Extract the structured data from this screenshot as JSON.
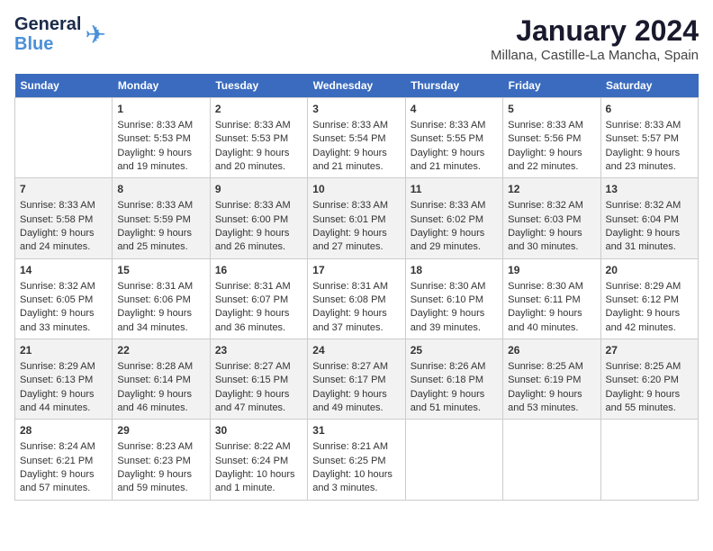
{
  "header": {
    "logo_line1": "General",
    "logo_line2": "Blue",
    "title": "January 2024",
    "subtitle": "Millana, Castille-La Mancha, Spain"
  },
  "weekdays": [
    "Sunday",
    "Monday",
    "Tuesday",
    "Wednesday",
    "Thursday",
    "Friday",
    "Saturday"
  ],
  "weeks": [
    [
      {
        "day": "",
        "empty": true
      },
      {
        "day": "1",
        "sunrise": "8:33 AM",
        "sunset": "5:53 PM",
        "daylight": "9 hours and 19 minutes."
      },
      {
        "day": "2",
        "sunrise": "8:33 AM",
        "sunset": "5:53 PM",
        "daylight": "9 hours and 20 minutes."
      },
      {
        "day": "3",
        "sunrise": "8:33 AM",
        "sunset": "5:54 PM",
        "daylight": "9 hours and 21 minutes."
      },
      {
        "day": "4",
        "sunrise": "8:33 AM",
        "sunset": "5:55 PM",
        "daylight": "9 hours and 21 minutes."
      },
      {
        "day": "5",
        "sunrise": "8:33 AM",
        "sunset": "5:56 PM",
        "daylight": "9 hours and 22 minutes."
      },
      {
        "day": "6",
        "sunrise": "8:33 AM",
        "sunset": "5:57 PM",
        "daylight": "9 hours and 23 minutes."
      }
    ],
    [
      {
        "day": "7",
        "sunrise": "8:33 AM",
        "sunset": "5:58 PM",
        "daylight": "9 hours and 24 minutes."
      },
      {
        "day": "8",
        "sunrise": "8:33 AM",
        "sunset": "5:59 PM",
        "daylight": "9 hours and 25 minutes."
      },
      {
        "day": "9",
        "sunrise": "8:33 AM",
        "sunset": "6:00 PM",
        "daylight": "9 hours and 26 minutes."
      },
      {
        "day": "10",
        "sunrise": "8:33 AM",
        "sunset": "6:01 PM",
        "daylight": "9 hours and 27 minutes."
      },
      {
        "day": "11",
        "sunrise": "8:33 AM",
        "sunset": "6:02 PM",
        "daylight": "9 hours and 29 minutes."
      },
      {
        "day": "12",
        "sunrise": "8:32 AM",
        "sunset": "6:03 PM",
        "daylight": "9 hours and 30 minutes."
      },
      {
        "day": "13",
        "sunrise": "8:32 AM",
        "sunset": "6:04 PM",
        "daylight": "9 hours and 31 minutes."
      }
    ],
    [
      {
        "day": "14",
        "sunrise": "8:32 AM",
        "sunset": "6:05 PM",
        "daylight": "9 hours and 33 minutes."
      },
      {
        "day": "15",
        "sunrise": "8:31 AM",
        "sunset": "6:06 PM",
        "daylight": "9 hours and 34 minutes."
      },
      {
        "day": "16",
        "sunrise": "8:31 AM",
        "sunset": "6:07 PM",
        "daylight": "9 hours and 36 minutes."
      },
      {
        "day": "17",
        "sunrise": "8:31 AM",
        "sunset": "6:08 PM",
        "daylight": "9 hours and 37 minutes."
      },
      {
        "day": "18",
        "sunrise": "8:30 AM",
        "sunset": "6:10 PM",
        "daylight": "9 hours and 39 minutes."
      },
      {
        "day": "19",
        "sunrise": "8:30 AM",
        "sunset": "6:11 PM",
        "daylight": "9 hours and 40 minutes."
      },
      {
        "day": "20",
        "sunrise": "8:29 AM",
        "sunset": "6:12 PM",
        "daylight": "9 hours and 42 minutes."
      }
    ],
    [
      {
        "day": "21",
        "sunrise": "8:29 AM",
        "sunset": "6:13 PM",
        "daylight": "9 hours and 44 minutes."
      },
      {
        "day": "22",
        "sunrise": "8:28 AM",
        "sunset": "6:14 PM",
        "daylight": "9 hours and 46 minutes."
      },
      {
        "day": "23",
        "sunrise": "8:27 AM",
        "sunset": "6:15 PM",
        "daylight": "9 hours and 47 minutes."
      },
      {
        "day": "24",
        "sunrise": "8:27 AM",
        "sunset": "6:17 PM",
        "daylight": "9 hours and 49 minutes."
      },
      {
        "day": "25",
        "sunrise": "8:26 AM",
        "sunset": "6:18 PM",
        "daylight": "9 hours and 51 minutes."
      },
      {
        "day": "26",
        "sunrise": "8:25 AM",
        "sunset": "6:19 PM",
        "daylight": "9 hours and 53 minutes."
      },
      {
        "day": "27",
        "sunrise": "8:25 AM",
        "sunset": "6:20 PM",
        "daylight": "9 hours and 55 minutes."
      }
    ],
    [
      {
        "day": "28",
        "sunrise": "8:24 AM",
        "sunset": "6:21 PM",
        "daylight": "9 hours and 57 minutes."
      },
      {
        "day": "29",
        "sunrise": "8:23 AM",
        "sunset": "6:23 PM",
        "daylight": "9 hours and 59 minutes."
      },
      {
        "day": "30",
        "sunrise": "8:22 AM",
        "sunset": "6:24 PM",
        "daylight": "10 hours and 1 minute."
      },
      {
        "day": "31",
        "sunrise": "8:21 AM",
        "sunset": "6:25 PM",
        "daylight": "10 hours and 3 minutes."
      },
      {
        "day": "",
        "empty": true
      },
      {
        "day": "",
        "empty": true
      },
      {
        "day": "",
        "empty": true
      }
    ]
  ]
}
